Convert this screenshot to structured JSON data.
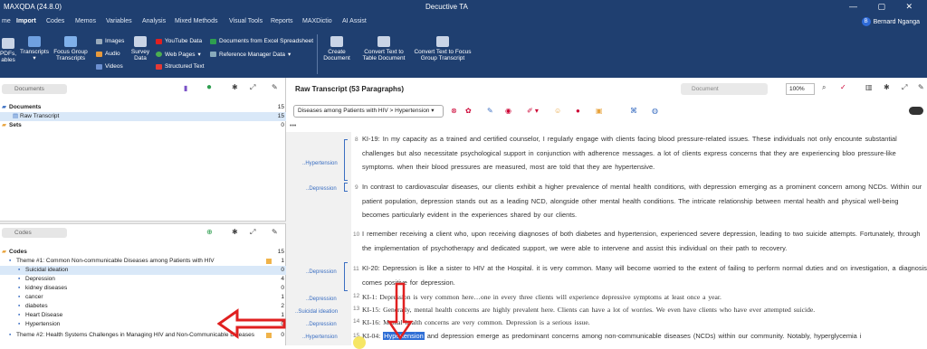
{
  "window": {
    "app_name": "MAXQDA (24.8.0)",
    "center_title": "Decuctive TA",
    "controls": "— ▢ ✕"
  },
  "menu": [
    "me",
    "Import",
    "Codes",
    "Memos",
    "Variables",
    "Analysis",
    "Mixed Methods",
    "Visual Tools",
    "Reports",
    "MAXDictio",
    "AI Assist"
  ],
  "menu_active": "Import",
  "user": {
    "initial": "B",
    "name": "Bernard Nganga"
  },
  "ribbon": {
    "b1": "PDFs,\nables",
    "b2": "Transcripts",
    "b3": "Focus Group\nTranscripts",
    "small1": [
      "Images",
      "Audio",
      "Videos"
    ],
    "b4": "Survey\nData",
    "small2": [
      "YouTube Data",
      "Web Pages",
      "Structured Text"
    ],
    "small3": [
      "Documents from Excel Spreadsheet",
      "Reference Manager Data"
    ],
    "b5": "Create\nDocument",
    "b6": "Convert Text to\nTable Document",
    "b7": "Convert Text to Focus\nGroup Transcript"
  },
  "documents": {
    "search": "Documents",
    "rows": [
      {
        "label": "Documents",
        "count": "15"
      },
      {
        "label": "Raw Transcript",
        "count": "15"
      },
      {
        "label": "Sets",
        "count": "0"
      }
    ]
  },
  "codes": {
    "search": "Codes",
    "rows": [
      {
        "label": "Codes",
        "count": "15"
      },
      {
        "label": "Theme #1: Common Non-communicable Diseases among Patients with HIV",
        "count": "1"
      },
      {
        "label": "Suicidal ideation",
        "count": "0"
      },
      {
        "label": "Depression",
        "count": "4"
      },
      {
        "label": "kidney diseases",
        "count": "0"
      },
      {
        "label": "cancer",
        "count": "1"
      },
      {
        "label": "diabetes",
        "count": "2"
      },
      {
        "label": "Heart Disease",
        "count": "1"
      },
      {
        "label": "Hypertension",
        "count": "0"
      },
      {
        "label": "Theme #2: Health Systems Challenges in Managing HIV  and Non-Communicable Diseases",
        "count": "0"
      }
    ]
  },
  "browser": {
    "title": "Raw Transcript  (53 Paragraphs)",
    "search_placeholder": "Document",
    "zoom": "100%",
    "code_dropdown": "Diseases among Patients with HIV > Hypertension",
    "ellipsis": "•••",
    "paragraphs": [
      {
        "n": "8",
        "text": "KI-19: In my capacity as a trained and certified counselor, I regularly engage with clients facing blood pressure-related issues. These individuals not only encounte substantial challenges but also necessitate psychological support in conjunction with adherence messages. a lot of clients express concerns that they are experiencing bloo pressure-like symptoms. when their blood pressures are measured, most are told that they are hypertensive."
      },
      {
        "n": "9",
        "text": "In contrast to cardiovascular diseases, our clients exhibit a higher prevalence of mental health conditions, with depression emerging as a prominent concern among NCDs. Within our patient population, depression stands out as a leading NCD, alongside other mental health conditions. The intricate relationship between mental health and physical well-being becomes particularly evident in the experiences shared by our clients."
      },
      {
        "n": "10",
        "text": "I remember receiving a client who, upon receiving diagnoses of both diabetes and hypertension, experienced severe depression, leading to two suicide attempts. Fortunately, through the implementation of psychotherapy and dedicated support, we were able to intervene and assist this individual on their path to recovery."
      },
      {
        "n": "11",
        "text": "KI-20: Depression is like a sister to HIV at the Hospital. it is very common. Many will become worried to the extent of failing to perform normal duties and on investigation, a diagnosis comes positive for depression."
      },
      {
        "n": "12",
        "text": "KI-1: Depression is very common here…one in every three clients will experience depressive symptoms at least once a year."
      },
      {
        "n": "13",
        "text": "KI-15: Generally, mental health concerns are highly prevalent here. Clients can have a lot of worries. We even have clients who have ever attempted suicide."
      },
      {
        "n": "14",
        "text": "KI-16: Mental health concerns are very common. Depression is a serious issue."
      },
      {
        "n": "15",
        "prefix": "KI-04: ",
        "highlight": "Hypertension",
        "text": " and depression emerge as predominant concerns among non-communicable diseases (NCDs) within our community. Notably, hyperglycemia i"
      }
    ],
    "code_labels": [
      "..Hypertension",
      "..Depression",
      "..Depression",
      "..Depression",
      "..Suicidal ideation",
      "..Depression",
      "..Hypertension"
    ]
  },
  "colors": {
    "titlebar": "#1f3f70",
    "selection": "#d9e8f8",
    "code_blue": "#3b6fc2",
    "arrow_red": "#e02020",
    "highlight": "#2f6fd6"
  }
}
